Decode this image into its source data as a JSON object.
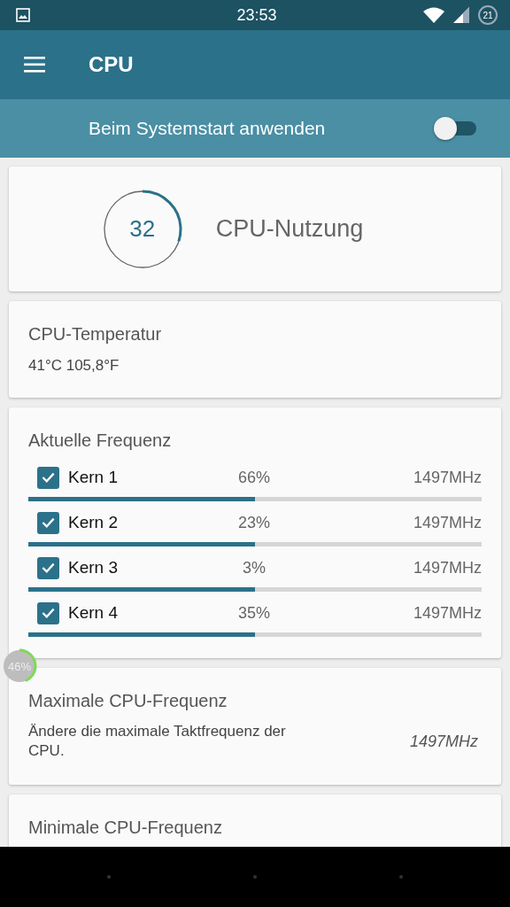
{
  "status_bar": {
    "time": "23:53",
    "battery": "21"
  },
  "toolbar": {
    "title": "CPU"
  },
  "boot_switch": {
    "label": "Beim Systemstart anwenden",
    "on": false
  },
  "usage": {
    "value": "32",
    "level": 0.3,
    "label": "CPU-Nutzung"
  },
  "temperature": {
    "title": "CPU-Temperatur",
    "value": "41°C 105,8°F"
  },
  "frequency": {
    "title": "Aktuelle Frequenz",
    "cores": [
      {
        "name": "Kern 1",
        "checked": true,
        "percent": "66%",
        "freq": "1497MHz",
        "level": 0.5
      },
      {
        "name": "Kern 2",
        "checked": true,
        "percent": "23%",
        "freq": "1497MHz",
        "level": 0.5
      },
      {
        "name": "Kern 3",
        "checked": true,
        "percent": "3%",
        "freq": "1497MHz",
        "level": 0.5
      },
      {
        "name": "Kern 4",
        "checked": true,
        "percent": "35%",
        "freq": "1497MHz",
        "level": 0.5
      }
    ]
  },
  "max_frequency": {
    "title": "Maximale CPU-Frequenz",
    "description": "Ändere die maximale Taktfrequenz der CPU.",
    "value": "1497MHz"
  },
  "min_frequency": {
    "title": "Minimale CPU-Frequenz"
  },
  "floating_badge": {
    "text": "46%",
    "level": 0.46
  }
}
